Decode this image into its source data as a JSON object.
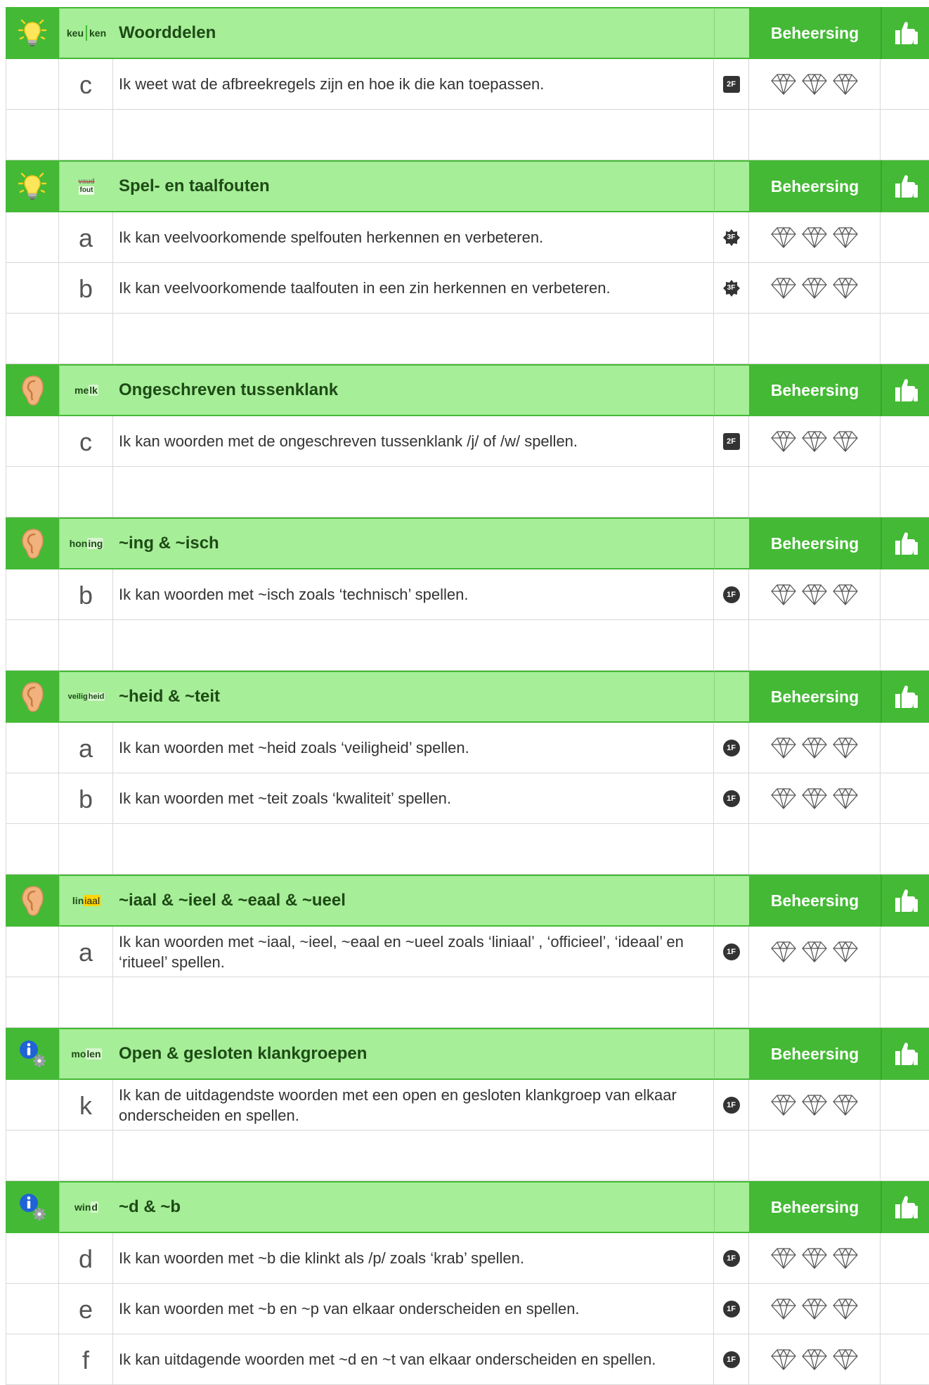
{
  "mastery_label": "Beheersing",
  "sections": [
    {
      "icon": "lightbulb-icon",
      "tag": {
        "type": "split",
        "a": "keu",
        "b": "ken"
      },
      "title": "Woorddelen",
      "items": [
        {
          "letter": "c",
          "text": "Ik weet wat de afbreekregels zijn en hoe ik die kan toepassen.",
          "level": "2F",
          "badge": "square"
        }
      ]
    },
    {
      "icon": "lightbulb-icon",
      "tag": {
        "type": "fout",
        "a": "vaud",
        "b": "fout"
      },
      "title": "Spel- en taalfouten",
      "items": [
        {
          "letter": "a",
          "text": "Ik kan veelvoorkomende spelfouten herkennen en verbeteren.",
          "level": "3F",
          "badge": "star"
        },
        {
          "letter": "b",
          "text": "Ik kan veelvoorkomende taalfouten in een zin herkennen en verbeteren.",
          "level": "3F",
          "badge": "star"
        }
      ]
    },
    {
      "icon": "ear-icon",
      "tag": {
        "type": "hl",
        "a": "me",
        "b": "lk"
      },
      "title": "Ongeschreven tussenklank",
      "items": [
        {
          "letter": "c",
          "text": "Ik kan woorden met de ongeschreven tussenklank /j/ of /w/ spellen.",
          "level": "2F",
          "badge": "square"
        }
      ]
    },
    {
      "icon": "ear-icon",
      "tag": {
        "type": "hl",
        "a": "hon",
        "b": "ing"
      },
      "title": "~ing & ~isch",
      "items": [
        {
          "letter": "b",
          "text": "Ik kan woorden met ~isch zoals ‘technisch’ spellen.",
          "level": "1F",
          "badge": "circle"
        }
      ]
    },
    {
      "icon": "ear-icon",
      "tag": {
        "type": "hl",
        "a": "veilig",
        "b": "heid",
        "small": true
      },
      "title": "~heid & ~teit",
      "items": [
        {
          "letter": "a",
          "text": "Ik kan woorden met ~heid zoals ‘veiligheid’ spellen.",
          "level": "1F",
          "badge": "circle"
        },
        {
          "letter": "b",
          "text": "Ik kan woorden met ~teit zoals ‘kwaliteit’ spellen.",
          "level": "1F",
          "badge": "circle"
        }
      ]
    },
    {
      "icon": "ear-icon",
      "tag": {
        "type": "yellow",
        "a": "lin",
        "b": "iaal"
      },
      "title": "~iaal & ~ieel & ~eaal & ~ueel",
      "items": [
        {
          "letter": "a",
          "text": "Ik kan woorden met ~iaal, ~ieel, ~eaal en ~ueel zoals ‘liniaal’ , ‘officieel’, ‘ideaal’ en ‘ritueel’ spellen.",
          "level": "1F",
          "badge": "circle"
        }
      ]
    },
    {
      "icon": "info-gear-icon",
      "tag": {
        "type": "hl",
        "a": "mo",
        "b": "len"
      },
      "title": "Open & gesloten klankgroepen",
      "items": [
        {
          "letter": "k",
          "text": "Ik kan de uitdagendste woorden met een open en gesloten klankgroep van elkaar onderscheiden en spellen.",
          "level": "1F",
          "badge": "circle"
        }
      ]
    },
    {
      "icon": "info-gear-icon",
      "tag": {
        "type": "hl",
        "a": "win",
        "b": "d"
      },
      "title": "~d & ~b",
      "items": [
        {
          "letter": "d",
          "text": "Ik kan woorden met ~b die klinkt als /p/ zoals ‘krab’ spellen.",
          "level": "1F",
          "badge": "circle"
        },
        {
          "letter": "e",
          "text": "Ik kan woorden met ~b en ~p van elkaar onderscheiden en spellen.",
          "level": "1F",
          "badge": "circle"
        },
        {
          "letter": "f",
          "text": "Ik kan uitdagende woorden met ~d en ~t van elkaar onderscheiden en spellen.",
          "level": "1F",
          "badge": "circle"
        }
      ]
    }
  ]
}
